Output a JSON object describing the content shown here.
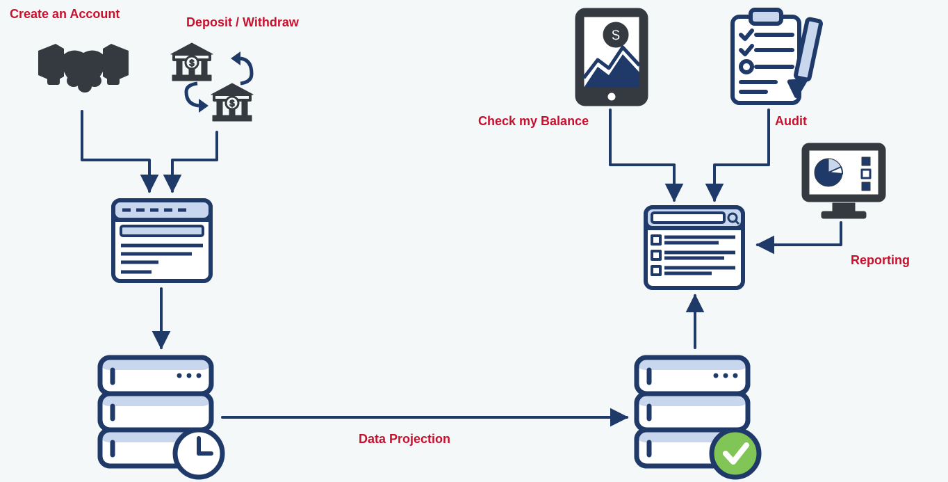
{
  "labels": {
    "create_account": "Create an Account",
    "deposit_withdraw": "Deposit / Withdraw",
    "check_balance": "Check my Balance",
    "audit": "Audit",
    "reporting": "Reporting",
    "data_projection": "Data Projection"
  },
  "colors": {
    "stroke": "#1f3a68",
    "fill_light": "#c9d7ee",
    "accent_red": "#c8102e",
    "success_green": "#81c557",
    "icon_dark": "#353a40",
    "bg": "#f4f8f8"
  },
  "nodes": [
    {
      "id": "create-account",
      "kind": "handshake",
      "label_key": "create_account"
    },
    {
      "id": "deposit-withdraw",
      "kind": "bank-transfer",
      "label_key": "deposit_withdraw"
    },
    {
      "id": "write-ui",
      "kind": "browser-form"
    },
    {
      "id": "write-store",
      "kind": "server-clock"
    },
    {
      "id": "read-store",
      "kind": "server-check"
    },
    {
      "id": "read-ui",
      "kind": "browser-search"
    },
    {
      "id": "check-balance",
      "kind": "tablet-chart",
      "label_key": "check_balance"
    },
    {
      "id": "audit",
      "kind": "clipboard-pencil",
      "label_key": "audit"
    },
    {
      "id": "reporting",
      "kind": "monitor-dashboard",
      "label_key": "reporting"
    }
  ],
  "edges": [
    {
      "from": "create-account",
      "to": "write-ui"
    },
    {
      "from": "deposit-withdraw",
      "to": "write-ui"
    },
    {
      "from": "write-ui",
      "to": "write-store"
    },
    {
      "from": "write-store",
      "to": "read-store",
      "label_key": "data_projection"
    },
    {
      "from": "read-store",
      "to": "read-ui"
    },
    {
      "from": "check-balance",
      "to": "read-ui"
    },
    {
      "from": "audit",
      "to": "read-ui"
    },
    {
      "from": "reporting",
      "to": "read-ui"
    }
  ]
}
